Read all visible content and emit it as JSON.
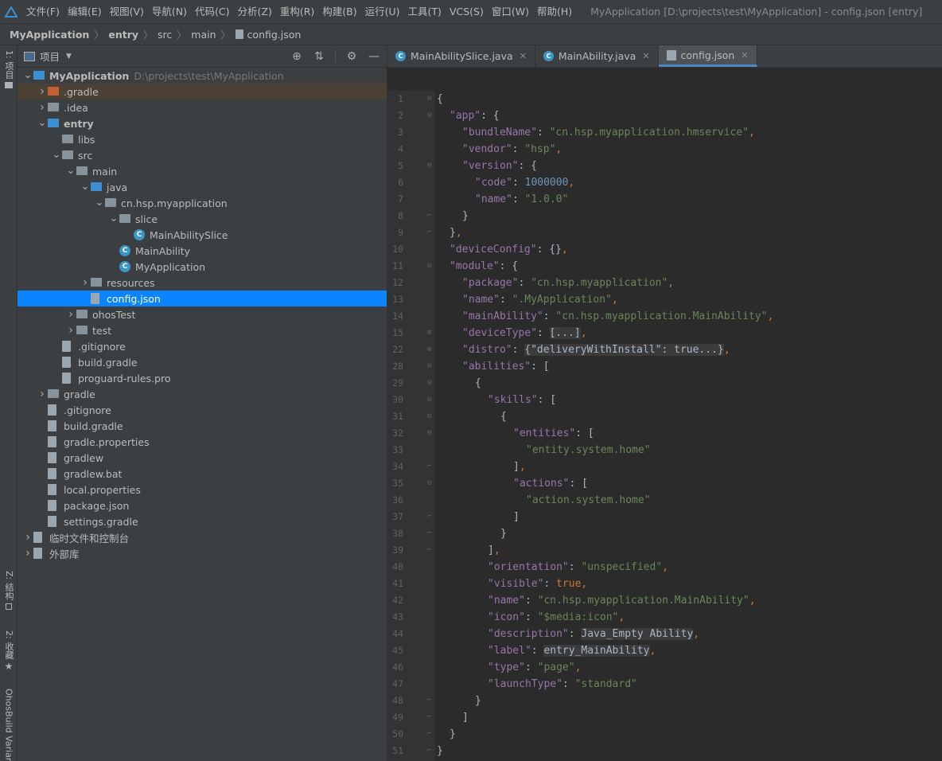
{
  "menu": {
    "items": [
      "文件(F)",
      "编辑(E)",
      "视图(V)",
      "导航(N)",
      "代码(C)",
      "分析(Z)",
      "重构(R)",
      "构建(B)",
      "运行(U)",
      "工具(T)",
      "VCS(S)",
      "窗口(W)",
      "帮助(H)"
    ],
    "window_title": "MyApplication [D:\\projects\\test\\MyApplication] - config.json [entry]"
  },
  "breadcrumb": [
    "MyApplication",
    "entry",
    "src",
    "main",
    "config.json"
  ],
  "left_strip": {
    "project_tab": "1: 项目",
    "structure_tab": "Z: 结构",
    "favorites_tab": "2: 收藏",
    "build_variants_tab": "OhosBuild Variants"
  },
  "project_panel": {
    "title": "项目"
  },
  "tree": [
    {
      "name": "MyApplication",
      "path": "D:\\projects\\test\\MyApplication",
      "depth": 0,
      "arrow": "down",
      "icon": "folder-blue",
      "bold": true
    },
    {
      "name": ".gradle",
      "depth": 1,
      "arrow": "right",
      "icon": "folder-orange"
    },
    {
      "name": ".idea",
      "depth": 1,
      "arrow": "right",
      "icon": "folder"
    },
    {
      "name": "entry",
      "depth": 1,
      "arrow": "down",
      "icon": "folder-blue",
      "bold": true
    },
    {
      "name": "libs",
      "depth": 2,
      "arrow": "",
      "icon": "folder"
    },
    {
      "name": "src",
      "depth": 2,
      "arrow": "down",
      "icon": "folder"
    },
    {
      "name": "main",
      "depth": 3,
      "arrow": "down",
      "icon": "folder"
    },
    {
      "name": "java",
      "depth": 4,
      "arrow": "down",
      "icon": "folder-blue"
    },
    {
      "name": "cn.hsp.myapplication",
      "depth": 5,
      "arrow": "down",
      "icon": "folder"
    },
    {
      "name": "slice",
      "depth": 6,
      "arrow": "down",
      "icon": "folder"
    },
    {
      "name": "MainAbilitySlice",
      "depth": 7,
      "arrow": "",
      "icon": "class"
    },
    {
      "name": "MainAbility",
      "depth": 6,
      "arrow": "",
      "icon": "class"
    },
    {
      "name": "MyApplication",
      "depth": 6,
      "arrow": "",
      "icon": "class"
    },
    {
      "name": "resources",
      "depth": 4,
      "arrow": "right",
      "icon": "folder"
    },
    {
      "name": "config.json",
      "depth": 4,
      "arrow": "",
      "icon": "file"
    },
    {
      "name": "ohosTest",
      "depth": 3,
      "arrow": "right",
      "icon": "folder"
    },
    {
      "name": "test",
      "depth": 3,
      "arrow": "right",
      "icon": "folder"
    },
    {
      "name": ".gitignore",
      "depth": 2,
      "arrow": "",
      "icon": "file"
    },
    {
      "name": "build.gradle",
      "depth": 2,
      "arrow": "",
      "icon": "file"
    },
    {
      "name": "proguard-rules.pro",
      "depth": 2,
      "arrow": "",
      "icon": "file"
    },
    {
      "name": "gradle",
      "depth": 1,
      "arrow": "right",
      "icon": "folder"
    },
    {
      "name": ".gitignore",
      "depth": 1,
      "arrow": "",
      "icon": "file"
    },
    {
      "name": "build.gradle",
      "depth": 1,
      "arrow": "",
      "icon": "file"
    },
    {
      "name": "gradle.properties",
      "depth": 1,
      "arrow": "",
      "icon": "file"
    },
    {
      "name": "gradlew",
      "depth": 1,
      "arrow": "",
      "icon": "file"
    },
    {
      "name": "gradlew.bat",
      "depth": 1,
      "arrow": "",
      "icon": "file"
    },
    {
      "name": "local.properties",
      "depth": 1,
      "arrow": "",
      "icon": "file"
    },
    {
      "name": "package.json",
      "depth": 1,
      "arrow": "",
      "icon": "file"
    },
    {
      "name": "settings.gradle",
      "depth": 1,
      "arrow": "",
      "icon": "file"
    },
    {
      "name": "临时文件和控制台",
      "depth": 0,
      "arrow": "right",
      "icon": "file"
    },
    {
      "name": "外部库",
      "depth": 0,
      "arrow": "right",
      "icon": "file"
    }
  ],
  "selected_tree_item": "config.json",
  "tabs": [
    {
      "label": "MainAbilitySlice.java",
      "icon": "class",
      "active": false
    },
    {
      "label": "MainAbility.java",
      "icon": "class",
      "active": false
    },
    {
      "label": "config.json",
      "icon": "file",
      "active": true
    }
  ],
  "colors": {
    "key": "#9876aa",
    "string": "#6a8759",
    "number": "#6897bb",
    "keyword": "#cc7832",
    "punct": "#a9b7c6",
    "selection": "#0a84ff",
    "active_tab_underline": "#4a88c7"
  },
  "code": [
    {
      "n": "1",
      "fold": "open",
      "i": 0,
      "t": [
        [
          "p",
          "{"
        ]
      ]
    },
    {
      "n": "2",
      "fold": "open",
      "i": 1,
      "t": [
        [
          "k",
          "\"app\""
        ],
        [
          "p",
          ": {"
        ]
      ]
    },
    {
      "n": "3",
      "fold": "",
      "i": 2,
      "t": [
        [
          "k",
          "\"bundleName\""
        ],
        [
          "p",
          ": "
        ],
        [
          "s",
          "\"cn.hsp.myapplication.hmservice\""
        ],
        [
          "b",
          ","
        ]
      ]
    },
    {
      "n": "4",
      "fold": "",
      "i": 2,
      "t": [
        [
          "k",
          "\"vendor\""
        ],
        [
          "p",
          ": "
        ],
        [
          "s",
          "\"hsp\""
        ],
        [
          "b",
          ","
        ]
      ]
    },
    {
      "n": "5",
      "fold": "open",
      "i": 2,
      "t": [
        [
          "k",
          "\"version\""
        ],
        [
          "p",
          ": {"
        ]
      ]
    },
    {
      "n": "6",
      "fold": "",
      "i": 3,
      "t": [
        [
          "k",
          "\"code\""
        ],
        [
          "p",
          ": "
        ],
        [
          "n",
          "1000000"
        ],
        [
          "b",
          ","
        ]
      ]
    },
    {
      "n": "7",
      "fold": "",
      "i": 3,
      "t": [
        [
          "k",
          "\"name\""
        ],
        [
          "p",
          ": "
        ],
        [
          "s",
          "\"1.0.0\""
        ]
      ]
    },
    {
      "n": "8",
      "fold": "close",
      "i": 2,
      "t": [
        [
          "p",
          "}"
        ]
      ]
    },
    {
      "n": "9",
      "fold": "close",
      "i": 1,
      "t": [
        [
          "p",
          "}"
        ],
        [
          "b",
          ","
        ]
      ]
    },
    {
      "n": "10",
      "fold": "",
      "i": 1,
      "t": [
        [
          "k",
          "\"deviceConfig\""
        ],
        [
          "p",
          ": {}"
        ],
        [
          "b",
          ","
        ]
      ]
    },
    {
      "n": "11",
      "fold": "open",
      "i": 1,
      "t": [
        [
          "k",
          "\"module\""
        ],
        [
          "p",
          ": {"
        ]
      ]
    },
    {
      "n": "12",
      "fold": "",
      "i": 2,
      "t": [
        [
          "k",
          "\"package\""
        ],
        [
          "p",
          ": "
        ],
        [
          "s",
          "\"cn.hsp.myapplication\""
        ],
        [
          "b",
          ","
        ]
      ]
    },
    {
      "n": "13",
      "fold": "",
      "i": 2,
      "t": [
        [
          "k",
          "\"name\""
        ],
        [
          "p",
          ": "
        ],
        [
          "s",
          "\".MyApplication\""
        ],
        [
          "b",
          ","
        ]
      ]
    },
    {
      "n": "14",
      "fold": "",
      "i": 2,
      "t": [
        [
          "k",
          "\"mainAbility\""
        ],
        [
          "p",
          ": "
        ],
        [
          "s",
          "\"cn.hsp.myapplication.MainAbility\""
        ],
        [
          "b",
          ","
        ]
      ]
    },
    {
      "n": "15",
      "fold": "plus",
      "i": 2,
      "t": [
        [
          "k",
          "\"deviceType\""
        ],
        [
          "p",
          ": "
        ],
        [
          "fb",
          "[...]"
        ],
        [
          "b",
          ","
        ]
      ]
    },
    {
      "n": "22",
      "fold": "plus",
      "i": 2,
      "t": [
        [
          "k",
          "\"distro\""
        ],
        [
          "p",
          ": "
        ],
        [
          "fb",
          "{\"deliveryWithInstall\": true...}"
        ],
        [
          "b",
          ","
        ]
      ]
    },
    {
      "n": "28",
      "fold": "open",
      "i": 2,
      "t": [
        [
          "k",
          "\"abilities\""
        ],
        [
          "p",
          ": ["
        ]
      ]
    },
    {
      "n": "29",
      "fold": "open",
      "i": 3,
      "t": [
        [
          "p",
          "{"
        ]
      ]
    },
    {
      "n": "30",
      "fold": "open",
      "i": 4,
      "t": [
        [
          "k",
          "\"skills\""
        ],
        [
          "p",
          ": ["
        ]
      ]
    },
    {
      "n": "31",
      "fold": "open",
      "i": 5,
      "t": [
        [
          "p",
          "{"
        ]
      ]
    },
    {
      "n": "32",
      "fold": "open",
      "i": 6,
      "t": [
        [
          "k",
          "\"entities\""
        ],
        [
          "p",
          ": ["
        ]
      ]
    },
    {
      "n": "33",
      "fold": "",
      "i": 7,
      "t": [
        [
          "s",
          "\"entity.system.home\""
        ]
      ]
    },
    {
      "n": "34",
      "fold": "close",
      "i": 6,
      "t": [
        [
          "p",
          "]"
        ],
        [
          "b",
          ","
        ]
      ]
    },
    {
      "n": "35",
      "fold": "open",
      "i": 6,
      "t": [
        [
          "k",
          "\"actions\""
        ],
        [
          "p",
          ": ["
        ]
      ]
    },
    {
      "n": "36",
      "fold": "",
      "i": 7,
      "t": [
        [
          "s",
          "\"action.system.home\""
        ]
      ]
    },
    {
      "n": "37",
      "fold": "close",
      "i": 6,
      "t": [
        [
          "p",
          "]"
        ]
      ]
    },
    {
      "n": "38",
      "fold": "close",
      "i": 5,
      "t": [
        [
          "p",
          "}"
        ]
      ]
    },
    {
      "n": "39",
      "fold": "close",
      "i": 4,
      "t": [
        [
          "p",
          "]"
        ],
        [
          "b",
          ","
        ]
      ]
    },
    {
      "n": "40",
      "fold": "",
      "i": 4,
      "t": [
        [
          "k",
          "\"orientation\""
        ],
        [
          "p",
          ": "
        ],
        [
          "s",
          "\"unspecified\""
        ],
        [
          "b",
          ","
        ]
      ]
    },
    {
      "n": "41",
      "fold": "",
      "i": 4,
      "t": [
        [
          "k",
          "\"visible\""
        ],
        [
          "p",
          ": "
        ],
        [
          "b",
          "true,"
        ]
      ]
    },
    {
      "n": "42",
      "fold": "",
      "i": 4,
      "t": [
        [
          "k",
          "\"name\""
        ],
        [
          "p",
          ": "
        ],
        [
          "s",
          "\"cn.hsp.myapplication.MainAbility\""
        ],
        [
          "b",
          ","
        ]
      ]
    },
    {
      "n": "43",
      "fold": "",
      "i": 4,
      "t": [
        [
          "k",
          "\"icon\""
        ],
        [
          "p",
          ": "
        ],
        [
          "s",
          "\"$media:icon\""
        ],
        [
          "b",
          ","
        ]
      ]
    },
    {
      "n": "44",
      "fold": "",
      "i": 4,
      "t": [
        [
          "k",
          "\"description\""
        ],
        [
          "p",
          ": "
        ],
        [
          "fb",
          "Java_Empty Ability"
        ],
        [
          "b",
          ","
        ]
      ]
    },
    {
      "n": "45",
      "fold": "",
      "i": 4,
      "t": [
        [
          "k",
          "\"label\""
        ],
        [
          "p",
          ": "
        ],
        [
          "fb",
          "entry_MainAbility"
        ],
        [
          "b",
          ","
        ]
      ]
    },
    {
      "n": "46",
      "fold": "",
      "i": 4,
      "t": [
        [
          "k",
          "\"type\""
        ],
        [
          "p",
          ": "
        ],
        [
          "s",
          "\"page\""
        ],
        [
          "b",
          ","
        ]
      ]
    },
    {
      "n": "47",
      "fold": "",
      "i": 4,
      "t": [
        [
          "k",
          "\"launchType\""
        ],
        [
          "p",
          ": "
        ],
        [
          "s",
          "\"standard\""
        ]
      ]
    },
    {
      "n": "48",
      "fold": "close",
      "i": 3,
      "t": [
        [
          "p",
          "}"
        ]
      ]
    },
    {
      "n": "49",
      "fold": "close",
      "i": 2,
      "t": [
        [
          "p",
          "]"
        ]
      ]
    },
    {
      "n": "50",
      "fold": "close",
      "i": 1,
      "t": [
        [
          "p",
          "}"
        ]
      ]
    },
    {
      "n": "51",
      "fold": "close",
      "i": 0,
      "t": [
        [
          "p",
          "}"
        ]
      ]
    }
  ]
}
